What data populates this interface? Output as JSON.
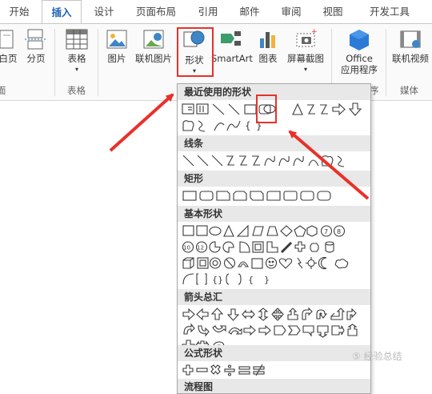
{
  "tabs": [
    {
      "label": "开始"
    },
    {
      "label": "插入"
    },
    {
      "label": "设计"
    },
    {
      "label": "页面布局"
    },
    {
      "label": "引用"
    },
    {
      "label": "邮件"
    },
    {
      "label": "审阅"
    },
    {
      "label": "视图"
    },
    {
      "label": "开发工具"
    }
  ],
  "ribbon": {
    "pages": {
      "cover_page_partial": "白页",
      "blank_page": "分页",
      "group_partial": "面"
    },
    "tables": {
      "table_label": "表格",
      "group": "表格"
    },
    "illustrations": {
      "pictures": "图片",
      "online_pictures": "联机图片",
      "shapes": "形状",
      "smartart": "SmartArt",
      "chart": "图表",
      "screenshot": "屏幕截图"
    },
    "addins": {
      "office_line1": "Office",
      "office_line2": "应用程序",
      "group_partial": "序"
    },
    "media": {
      "online_video": "联机视频",
      "group": "媒体"
    }
  },
  "dropdown": {
    "sections": [
      {
        "title": "最近使用的形状"
      },
      {
        "title": "线条"
      },
      {
        "title": "矩形"
      },
      {
        "title": "基本形状"
      },
      {
        "title": "箭头总汇"
      },
      {
        "title": "公式形状"
      },
      {
        "title": "流程图"
      }
    ]
  },
  "watermark": "⑤ 经验总结",
  "colors": {
    "accent_blue": "#1f62b0",
    "highlight_red": "#e8312a",
    "shape_stroke": "#3a3a3a"
  }
}
